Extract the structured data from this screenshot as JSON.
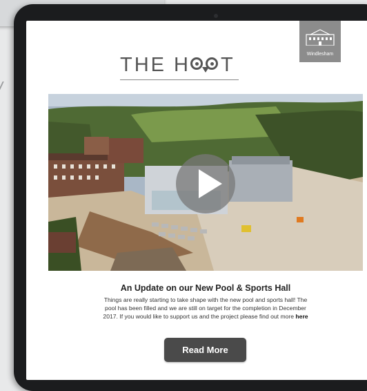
{
  "header": {
    "logo_text_left": "THE H",
    "logo_text_right": "T",
    "school_badge_label": "Windlesham"
  },
  "video": {
    "play_label": "Play video"
  },
  "article": {
    "title": "An Update on our New Pool & Sports Hall",
    "body_line1": "Things are really starting to take shape with the new pool and sports hall! The",
    "body_line2": "pool has been filled and we are still on target for the completion in December",
    "body_line3": "2017. If you would like to support us and the project please find out more",
    "link_label": "here",
    "button_label": "Read More"
  },
  "colors": {
    "tablet_frame": "#1b1c1e",
    "badge_bg": "#8c8c8c",
    "button_bg": "#4a4a4a"
  }
}
